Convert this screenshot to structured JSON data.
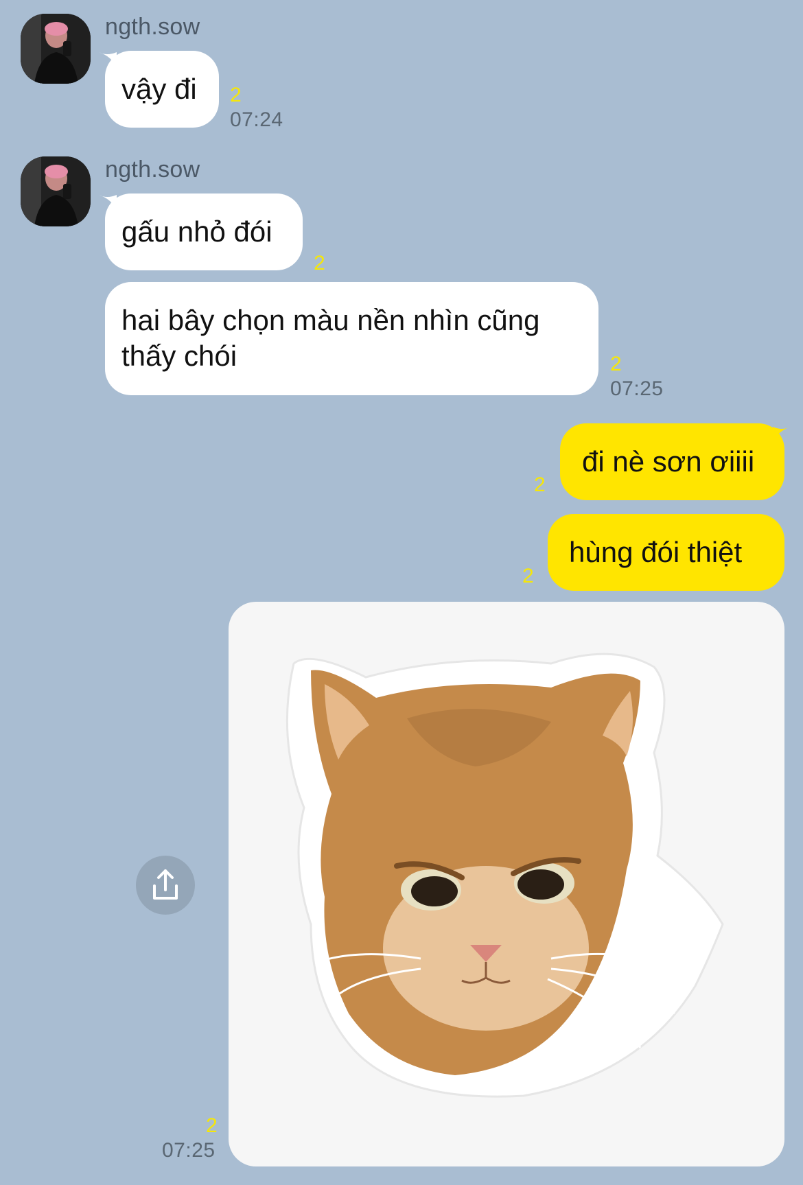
{
  "contact": {
    "name": "ngth.sow"
  },
  "messages": [
    {
      "from": "ngth.sow",
      "text": "vậy đi",
      "unread": "2",
      "time": "07:24"
    },
    {
      "from": "ngth.sow",
      "text": "gấu nhỏ đói",
      "unread": "2"
    },
    {
      "from": "ngth.sow",
      "text_line1": "hai bây chọn màu nền nhìn cũng",
      "text_line2": "thấy chói",
      "unread": "2",
      "time": "07:25"
    },
    {
      "from": "me",
      "text": "đi nè sơn ơiiii",
      "unread": "2"
    },
    {
      "from": "me",
      "text": "hùng đói thiệt",
      "unread": "2"
    },
    {
      "from": "me",
      "type": "image",
      "image_subject": "angry cat sticker",
      "unread": "2",
      "time": "07:25"
    }
  ],
  "colors": {
    "background": "#a9bdd2",
    "incoming_bubble": "#ffffff",
    "outgoing_bubble": "#ffe500",
    "unread_count": "#f5e60a",
    "timestamp": "#5a6773"
  },
  "icons": {
    "share": "share-icon"
  }
}
